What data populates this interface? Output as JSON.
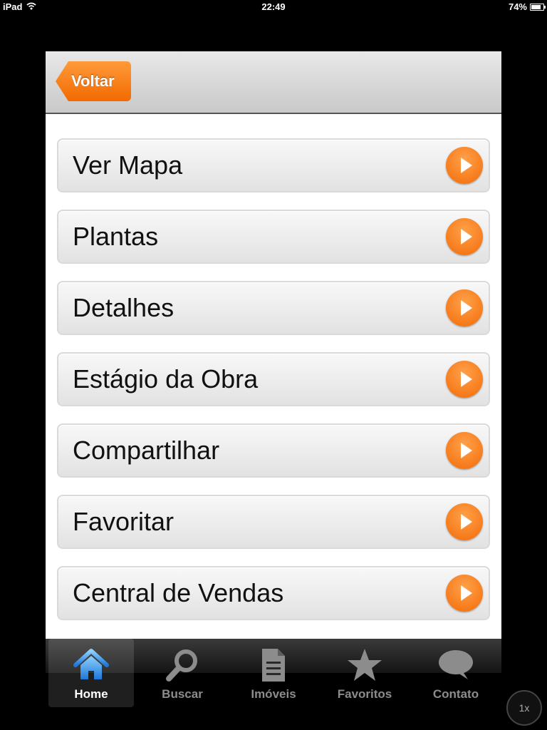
{
  "status_bar": {
    "device": "iPad",
    "time": "22:49",
    "battery": "74%"
  },
  "navbar": {
    "back_label": "Voltar"
  },
  "menu": {
    "items": [
      {
        "label": "Ver Mapa"
      },
      {
        "label": "Plantas"
      },
      {
        "label": "Detalhes"
      },
      {
        "label": "Estágio da Obra"
      },
      {
        "label": "Compartilhar"
      },
      {
        "label": "Favoritar"
      },
      {
        "label": "Central de Vendas"
      }
    ]
  },
  "tabbar": {
    "tabs": [
      {
        "label": "Home",
        "icon": "home-icon",
        "active": true
      },
      {
        "label": "Buscar",
        "icon": "search-icon",
        "active": false
      },
      {
        "label": "Imóveis",
        "icon": "document-icon",
        "active": false
      },
      {
        "label": "Favoritos",
        "icon": "star-icon",
        "active": false
      },
      {
        "label": "Contato",
        "icon": "speech-bubble-icon",
        "active": false
      }
    ]
  },
  "zoom": {
    "label": "1x"
  },
  "colors": {
    "accent": "#f26a00",
    "active_tab_icon": "#3b8fe0"
  }
}
